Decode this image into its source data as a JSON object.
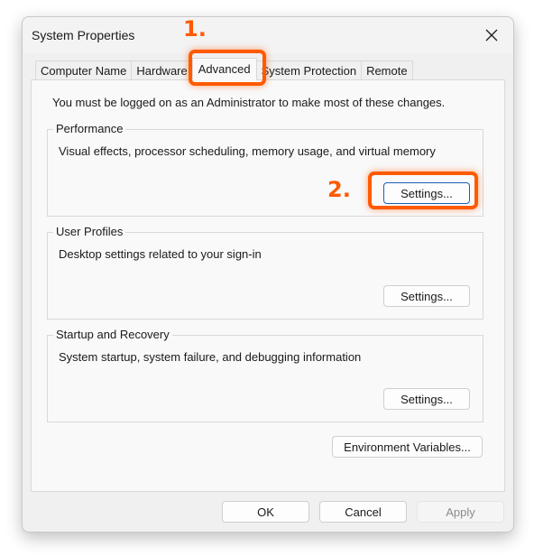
{
  "window": {
    "title": "System Properties",
    "close_icon": "close-icon"
  },
  "tabs": [
    {
      "label": "Computer Name",
      "active": false
    },
    {
      "label": "Hardware",
      "active": false
    },
    {
      "label": "Advanced",
      "active": true
    },
    {
      "label": "System Protection",
      "active": false
    },
    {
      "label": "Remote",
      "active": false
    }
  ],
  "advanced": {
    "admin_note": "You must be logged on as an Administrator to make most of these changes.",
    "groups": [
      {
        "label": "Performance",
        "description": "Visual effects, processor scheduling, memory usage, and virtual memory",
        "button": "Settings..."
      },
      {
        "label": "User Profiles",
        "description": "Desktop settings related to your sign-in",
        "button": "Settings..."
      },
      {
        "label": "Startup and Recovery",
        "description": "System startup, system failure, and debugging information",
        "button": "Settings..."
      }
    ],
    "env_button": "Environment Variables..."
  },
  "footer": {
    "ok": "OK",
    "cancel": "Cancel",
    "apply": "Apply",
    "apply_disabled": true
  },
  "annotations": {
    "step1": "1.",
    "step2": "2.",
    "highlight_color": "#ff5a00"
  }
}
